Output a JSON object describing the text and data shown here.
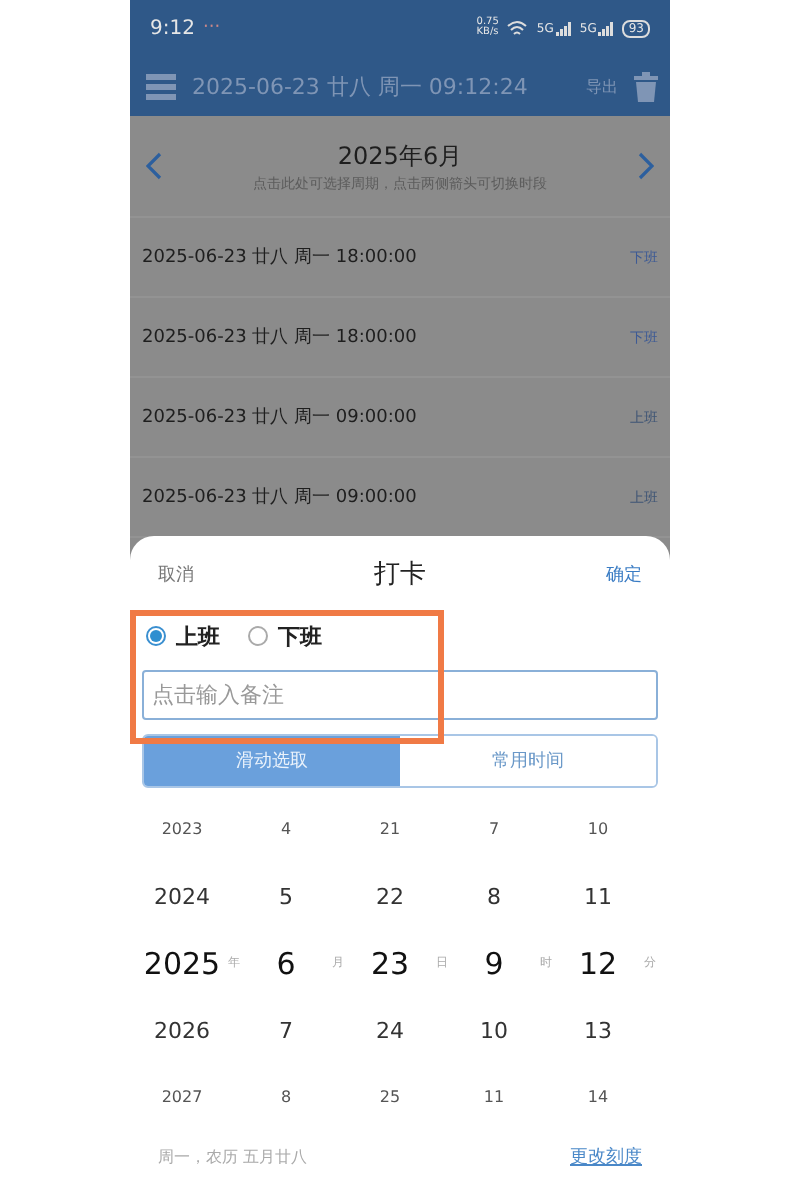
{
  "status_bar": {
    "time": "9:12",
    "dots": "···",
    "speed_value": "0.75",
    "speed_unit": "KB/s",
    "signals": [
      "5G",
      "5G"
    ],
    "battery": "93"
  },
  "toolbar": {
    "datetime": "2025-06-23 廿八 周一 09:12:24",
    "export": "导出"
  },
  "period": {
    "title": "2025年6月",
    "hint": "点击此处可选择周期，点击两侧箭头可切换时段"
  },
  "records": [
    {
      "time": "2025-06-23 廿八 周一 18:00:00",
      "type": "下班",
      "kind": "off"
    },
    {
      "time": "2025-06-23 廿八 周一 18:00:00",
      "type": "下班",
      "kind": "off"
    },
    {
      "time": "2025-06-23 廿八 周一 09:00:00",
      "type": "上班",
      "kind": "on"
    },
    {
      "time": "2025-06-23 廿八 周一 09:00:00",
      "type": "上班",
      "kind": "on"
    }
  ],
  "dialog": {
    "cancel": "取消",
    "title": "打卡",
    "confirm": "确定",
    "radios": [
      {
        "label": "上班",
        "selected": true
      },
      {
        "label": "下班",
        "selected": false
      }
    ],
    "note": {
      "placeholder": "点击输入备注"
    },
    "modes": [
      {
        "label": "滑动选取",
        "selected": true
      },
      {
        "label": "常用时间",
        "selected": false
      }
    ],
    "picker": [
      {
        "unit": "年",
        "items": [
          {
            "text": "2023",
            "selected": false
          },
          {
            "text": "2024",
            "selected": false
          },
          {
            "text": "2025",
            "selected": true
          },
          {
            "text": "2026",
            "selected": false
          },
          {
            "text": "2027",
            "selected": false
          }
        ]
      },
      {
        "unit": "月",
        "items": [
          {
            "text": "4",
            "selected": false
          },
          {
            "text": "5",
            "selected": false
          },
          {
            "text": "6",
            "selected": true
          },
          {
            "text": "7",
            "selected": false
          },
          {
            "text": "8",
            "selected": false
          }
        ]
      },
      {
        "unit": "日",
        "items": [
          {
            "text": "21",
            "selected": false
          },
          {
            "text": "22",
            "selected": false
          },
          {
            "text": "23",
            "selected": true
          },
          {
            "text": "24",
            "selected": false
          },
          {
            "text": "25",
            "selected": false
          }
        ]
      },
      {
        "unit": "时",
        "items": [
          {
            "text": "7",
            "selected": false
          },
          {
            "text": "8",
            "selected": false
          },
          {
            "text": "9",
            "selected": true
          },
          {
            "text": "10",
            "selected": false
          },
          {
            "text": "11",
            "selected": false
          }
        ]
      },
      {
        "unit": "分",
        "items": [
          {
            "text": "10",
            "selected": false
          },
          {
            "text": "11",
            "selected": false
          },
          {
            "text": "12",
            "selected": true
          },
          {
            "text": "13",
            "selected": false
          },
          {
            "text": "14",
            "selected": false
          }
        ]
      }
    ],
    "lunar": "周一，农历 五月廿八",
    "change_scale": "更改刻度"
  }
}
